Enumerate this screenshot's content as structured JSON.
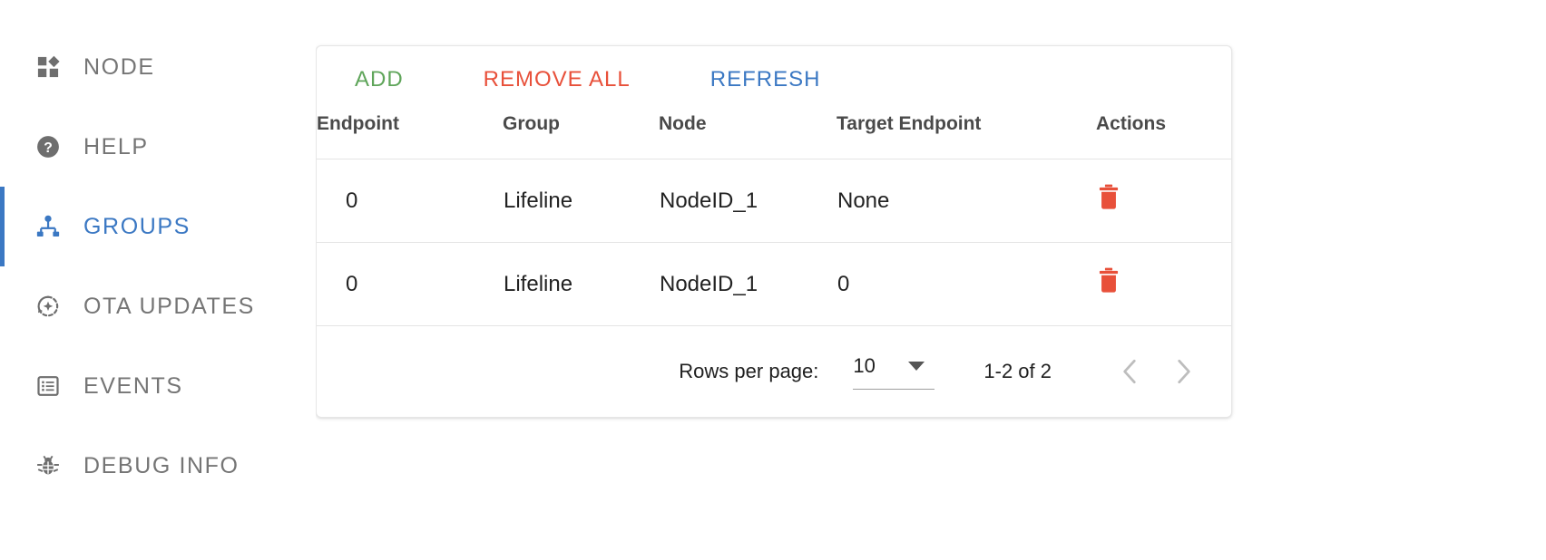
{
  "colors": {
    "accent_blue": "#3b78c3",
    "add_green": "#5fa55a",
    "remove_red": "#e8503a",
    "trash_red": "#e8503a",
    "muted_gray": "#757575",
    "disabled_gray": "#bdbdbd"
  },
  "sidebar": {
    "items": [
      {
        "label": "NODE",
        "icon": "dashboard-icon",
        "active": false
      },
      {
        "label": "HELP",
        "icon": "help-icon",
        "active": false
      },
      {
        "label": "GROUPS",
        "icon": "account-tree-icon",
        "active": true
      },
      {
        "label": "OTA UPDATES",
        "icon": "update-icon",
        "active": false
      },
      {
        "label": "EVENTS",
        "icon": "list-alt-icon",
        "active": false
      },
      {
        "label": "DEBUG INFO",
        "icon": "bug-icon",
        "active": false
      }
    ]
  },
  "toolbar": {
    "add_label": "ADD",
    "remove_all_label": "REMOVE ALL",
    "refresh_label": "REFRESH"
  },
  "table": {
    "headers": {
      "endpoint": "Endpoint",
      "group": "Group",
      "node": "Node",
      "target_endpoint": "Target Endpoint",
      "actions": "Actions"
    },
    "rows": [
      {
        "endpoint": "0",
        "group": "Lifeline",
        "node": "NodeID_1",
        "target_endpoint": "None",
        "action_icon": "delete-icon"
      },
      {
        "endpoint": "0",
        "group": "Lifeline",
        "node": "NodeID_1",
        "target_endpoint": "0",
        "action_icon": "delete-icon"
      }
    ]
  },
  "paginator": {
    "rows_per_page_label": "Rows per page:",
    "rows_per_page_value": "10",
    "rows_per_page_options": [
      "10"
    ],
    "range_label": "1-2 of 2",
    "previous_page_icon": "chevron-left-icon",
    "next_page_icon": "chevron-right-icon",
    "previous_enabled": false,
    "next_enabled": false
  }
}
